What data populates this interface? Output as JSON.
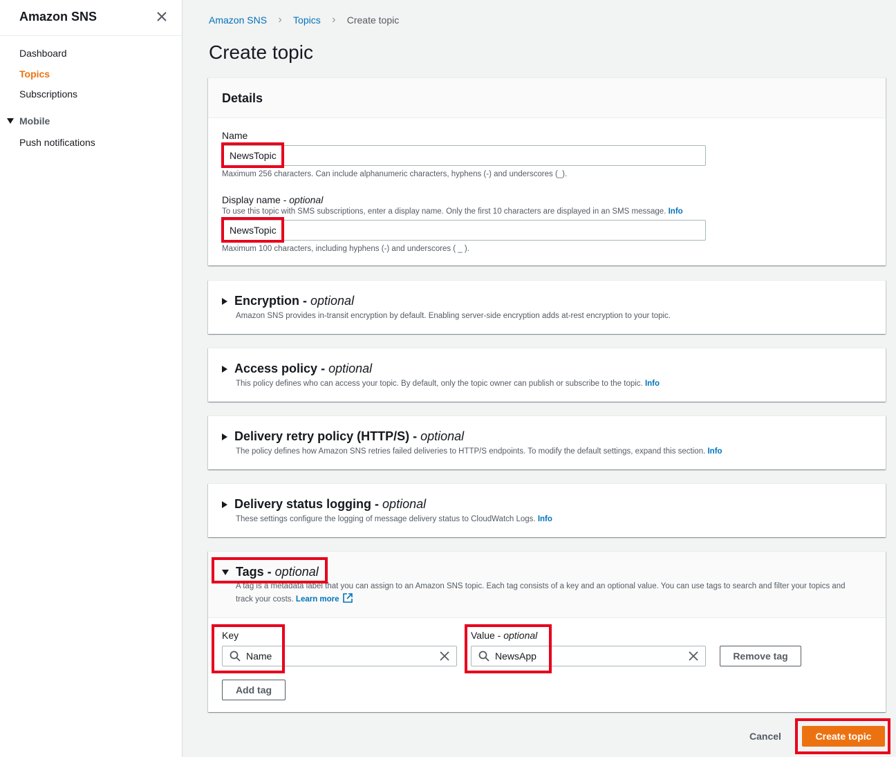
{
  "sidebar": {
    "title": "Amazon SNS",
    "items": [
      {
        "label": "Dashboard"
      },
      {
        "label": "Topics"
      },
      {
        "label": "Subscriptions"
      }
    ],
    "section": {
      "label": "Mobile",
      "items": [
        {
          "label": "Push notifications"
        }
      ]
    }
  },
  "breadcrumb": [
    "Amazon SNS",
    "Topics",
    "Create topic"
  ],
  "page_title": "Create topic",
  "details": {
    "title": "Details",
    "name": {
      "label": "Name",
      "value": "NewsTopic",
      "hint": "Maximum 256 characters. Can include alphanumeric characters, hyphens (-) and underscores (_)."
    },
    "display_name": {
      "label": "Display name - ",
      "label_optional": "optional",
      "description": "To use this topic with SMS subscriptions, enter a display name. Only the first 10 characters are displayed in an SMS message.",
      "info": "Info",
      "value": "NewsTopic",
      "hint": "Maximum 100 characters, including hyphens (-) and underscores ( _ )."
    }
  },
  "sections": [
    {
      "title": "Encryption - ",
      "optional": "optional",
      "desc": "Amazon SNS provides in-transit encryption by default. Enabling server-side encryption adds at-rest encryption to your topic.",
      "info": ""
    },
    {
      "title": "Access policy - ",
      "optional": "optional",
      "desc": "This policy defines who can access your topic. By default, only the topic owner can publish or subscribe to the topic.",
      "info": "Info"
    },
    {
      "title": "Delivery retry policy (HTTP/S) - ",
      "optional": "optional",
      "desc": "The policy defines how Amazon SNS retries failed deliveries to HTTP/S endpoints. To modify the default settings, expand this section.",
      "info": "Info"
    },
    {
      "title": "Delivery status logging - ",
      "optional": "optional",
      "desc": "These settings configure the logging of message delivery status to CloudWatch Logs.",
      "info": "Info"
    }
  ],
  "tags": {
    "title": "Tags - ",
    "optional": "optional",
    "desc_line1": "A tag is a metadata label that you can assign to an Amazon SNS topic. Each tag consists of a key and an optional value. You can use tags to search and filter your topics and",
    "desc_line2": "track your costs.",
    "learn_more": "Learn more",
    "key_label": "Key",
    "key_value": "Name",
    "value_label": "Value - ",
    "value_optional": "optional",
    "value_value": "NewsApp",
    "remove_tag": "Remove tag",
    "add_tag": "Add tag"
  },
  "footer": {
    "cancel": "Cancel",
    "create": "Create topic"
  },
  "colors": {
    "accent": "#ec7211",
    "link": "#0073bb",
    "highlight": "#e8001c"
  }
}
